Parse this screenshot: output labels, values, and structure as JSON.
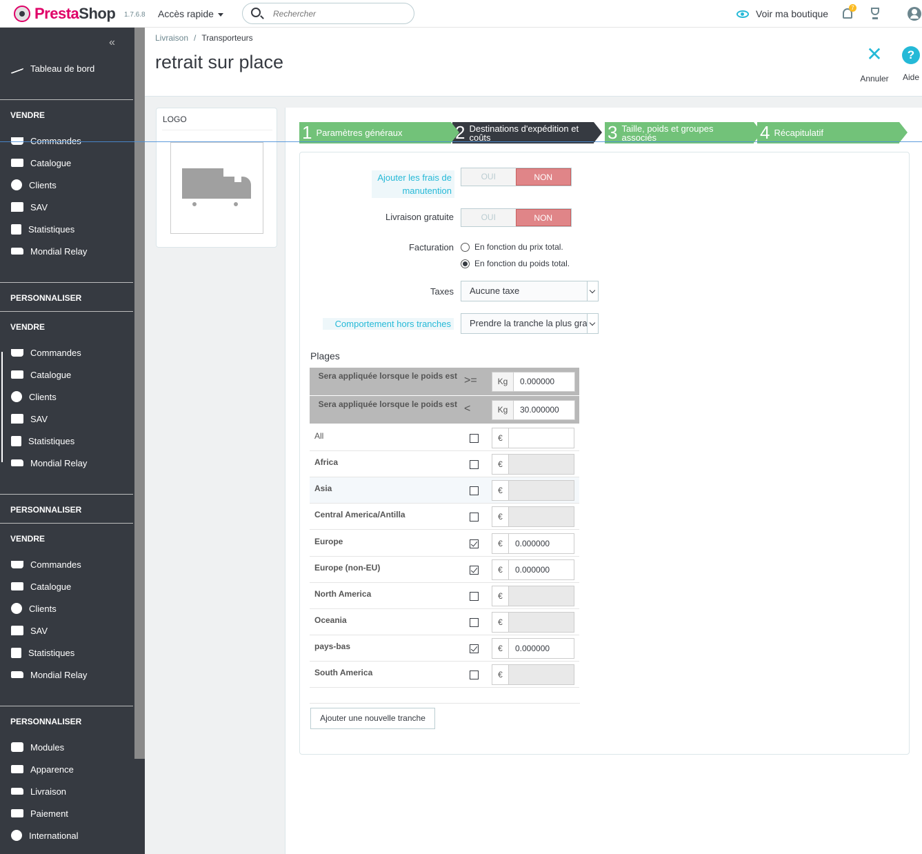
{
  "header": {
    "brand": "PrestaShop",
    "brand_part1": "Presta",
    "brand_part2": "Shop",
    "version": "1.7.6.8",
    "quick_access": "Accès rapide",
    "search_placeholder": "Rechercher",
    "view_shop": "Voir ma boutique",
    "notif_count": "7"
  },
  "sidebar": {
    "dashboard": "Tableau de bord",
    "sections": [
      {
        "title": "VENDRE",
        "items": [
          "Commandes",
          "Catalogue",
          "Clients",
          "SAV",
          "Statistiques",
          "Mondial Relay"
        ]
      },
      {
        "title": "PERSONNALISER"
      },
      {
        "title": "VENDRE",
        "items": [
          "Commandes",
          "Catalogue",
          "Clients",
          "SAV",
          "Statistiques",
          "Mondial Relay"
        ]
      },
      {
        "title": "PERSONNALISER"
      },
      {
        "title": "VENDRE",
        "items": [
          "Commandes",
          "Catalogue",
          "Clients",
          "SAV",
          "Statistiques",
          "Mondial Relay"
        ]
      },
      {
        "title": "PERSONNALISER",
        "items": [
          "Modules",
          "Apparence",
          "Livraison",
          "Paiement",
          "International"
        ]
      }
    ]
  },
  "page": {
    "breadcrumb": [
      "Livraison",
      "Transporteurs"
    ],
    "title": "retrait sur place",
    "toolbar": {
      "cancel": "Annuler",
      "help": "Aide"
    }
  },
  "logo_card": {
    "title": "LOGO"
  },
  "steps": [
    {
      "num": "1",
      "label": "Paramètres généraux"
    },
    {
      "num": "2",
      "label": "Destinations d'expédition et coûts"
    },
    {
      "num": "3",
      "label": "Taille, poids et groupes associés"
    },
    {
      "num": "4",
      "label": "Récapitulatif"
    }
  ],
  "form": {
    "handling_label": "Ajouter les frais de manutention",
    "free_label": "Livraison gratuite",
    "yes": "OUI",
    "no": "NON",
    "billing_label": "Facturation",
    "billing_options": [
      "En fonction du prix total.",
      "En fonction du poids total."
    ],
    "billing_selected": "En fonction du poids total.",
    "taxes_label": "Taxes",
    "taxes_value": "Aucune taxe",
    "out_of_range_label": "Comportement hors tranches",
    "out_of_range_value": "Prendre la tranche la plus grande"
  },
  "ranges": {
    "title": "Plages",
    "row_label": "Sera appliquée lorsque le poids est",
    "from_op": ">=",
    "to_op": "<",
    "unit": "Kg",
    "from_value": "0.000000",
    "to_value": "30.000000",
    "currency": "€",
    "zones": [
      {
        "name": "All",
        "checked": false,
        "value": ""
      },
      {
        "name": "Africa",
        "checked": false,
        "value": ""
      },
      {
        "name": "Asia",
        "checked": false,
        "value": ""
      },
      {
        "name": "Central America/Antilla",
        "checked": false,
        "value": ""
      },
      {
        "name": "Europe",
        "checked": true,
        "value": "0.000000"
      },
      {
        "name": "Europe (non-EU)",
        "checked": true,
        "value": "0.000000"
      },
      {
        "name": "North America",
        "checked": false,
        "value": ""
      },
      {
        "name": "Oceania",
        "checked": false,
        "value": ""
      },
      {
        "name": "pays-bas",
        "checked": true,
        "value": "0.000000"
      },
      {
        "name": "South America",
        "checked": false,
        "value": ""
      }
    ],
    "add_button": "Ajouter une nouvelle tranche"
  }
}
